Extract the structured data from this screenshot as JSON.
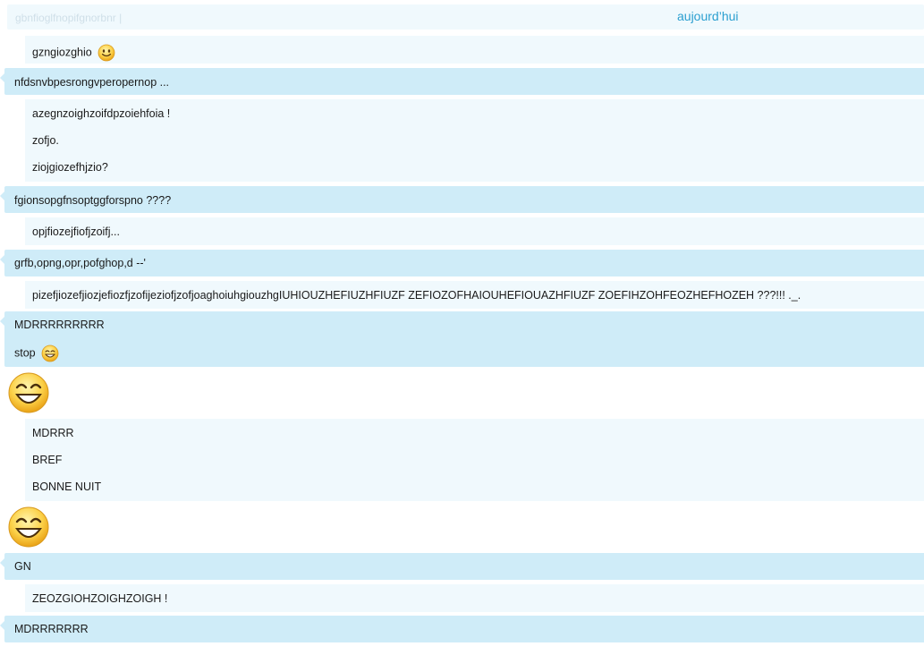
{
  "header": {
    "preview_text": "gbnfioglfnopifgnorbnr |",
    "day_label": "aujourd’hui"
  },
  "messages": {
    "m1": "gzngiozghio",
    "m2": "nfdsnvbpesrongvperopernop ...",
    "m3a": "azegnzoighzoifdpzoiehfoia !",
    "m3b": "zofjo.",
    "m3c": "ziojgiozefhjzio?",
    "m4": "fgionsopgfnsoptggforspno ????",
    "m5": "opjfiozejfiofjzoifj...",
    "m6": "grfb,opng,opr,pofghop,d --'",
    "m7": "pizefjiozefjiozjefiozfjzofijeziofjzofjoaghoiuhgiouzhgIUHIOUZHEFIUZHFIUZF ZEFIOZOFHAIOUHEFIOUAZHFIUZF ZOEFIHZOHFEOZHEFHOZEH ???!!! ._.",
    "m8a": "MDRRRRRRRRR",
    "m8b": "stop",
    "m9a": "MDRRR",
    "m9b": "BREF",
    "m9c": "BONNE NUIT",
    "m10": "GN",
    "m11": "ZEOZGIOHZOIGHZOIGH !",
    "m12": "MDRRRRRRR"
  },
  "emoticons": {
    "m1": "smile-emoticon-icon",
    "m8b": "laugh-emoticon-icon",
    "big1": "laugh-emoticon-icon",
    "big2": "laugh-emoticon-icon"
  },
  "colors": {
    "incoming_bg": "#f0f9fd",
    "outgoing_bg": "#cfecf8",
    "day_label": "#2b9fd0",
    "preview_text": "#cfdfe8"
  }
}
